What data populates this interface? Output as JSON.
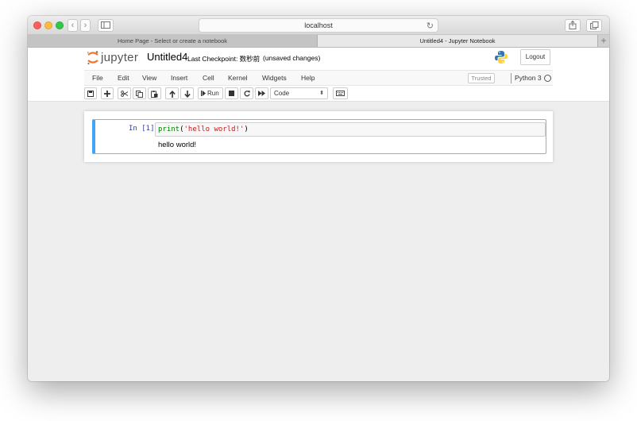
{
  "browser": {
    "address": "localhost",
    "tabs": [
      {
        "label": "Home Page - Select or create a notebook",
        "active": false
      },
      {
        "label": "Untitled4 - Jupyter Notebook",
        "active": true
      }
    ],
    "new_tab_label": "+"
  },
  "header": {
    "logo_text": "jupyter",
    "notebook_name": "Untitled4",
    "checkpoint": "Last Checkpoint: 数秒前",
    "autosave_status": "(unsaved changes)",
    "logout_label": "Logout"
  },
  "menubar": {
    "items": [
      "File",
      "Edit",
      "View",
      "Insert",
      "Cell",
      "Kernel",
      "Widgets",
      "Help"
    ],
    "trusted_label": "Trusted",
    "kernel_name": "Python 3"
  },
  "toolbar": {
    "run_label": "Run",
    "cell_type": "Code"
  },
  "cell": {
    "prompt": "In [1]:",
    "code_func": "print",
    "code_open": "(",
    "code_string": "'hello world!'",
    "code_close": ")",
    "output": "hello world!"
  },
  "colors": {
    "selected_cell_border": "#42a5f5",
    "prompt_color": "#303F9F",
    "builtin_color": "#008000",
    "string_color": "#ba2121"
  }
}
